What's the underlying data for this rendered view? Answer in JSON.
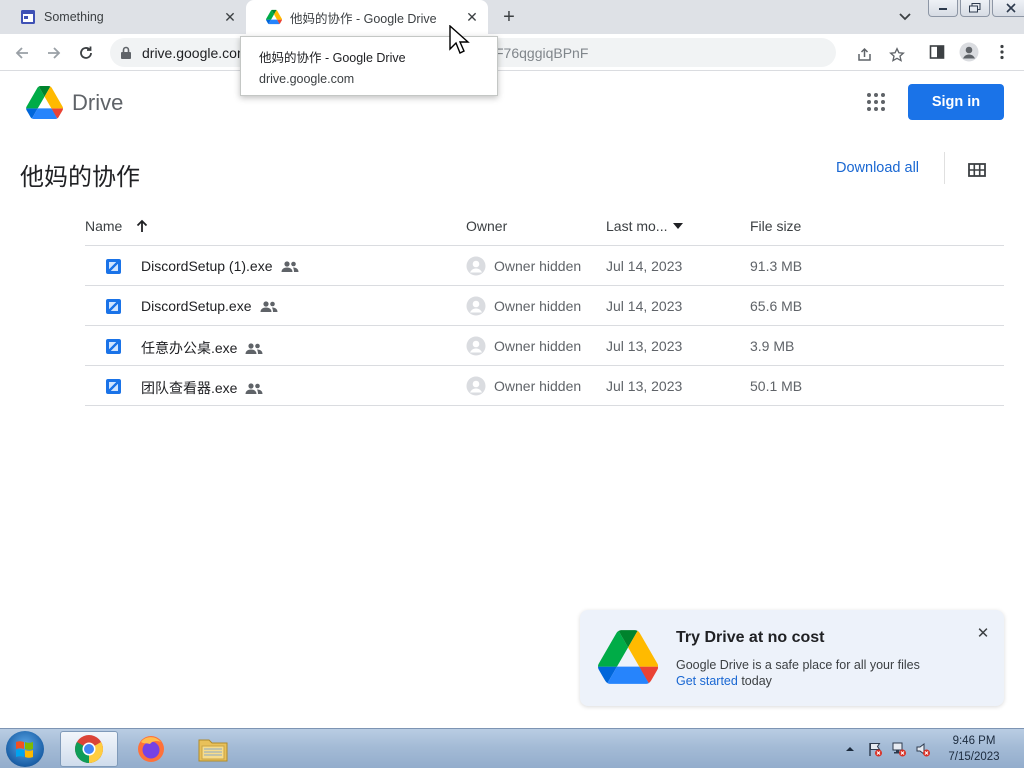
{
  "browser": {
    "tabs": [
      {
        "title": "Something",
        "active": false
      },
      {
        "title": "他妈的协作 - Google Drive",
        "active": true
      }
    ],
    "address": {
      "host": "drive.google.com",
      "path_tail": "F76qggiqBPnF"
    },
    "tooltip": {
      "title": "他妈的协作 - Google Drive",
      "url": "drive.google.com"
    }
  },
  "drive": {
    "brand": "Drive",
    "sign_in_label": "Sign in",
    "folder_title": "他妈的协作",
    "download_all_label": "Download all",
    "columns": {
      "name": "Name",
      "owner": "Owner",
      "modified": "Last mo...",
      "size": "File size"
    },
    "files": [
      {
        "name": "DiscordSetup (1).exe",
        "owner": "Owner hidden",
        "modified": "Jul 14, 2023",
        "size": "91.3 MB"
      },
      {
        "name": "DiscordSetup.exe",
        "owner": "Owner hidden",
        "modified": "Jul 14, 2023",
        "size": "65.6 MB"
      },
      {
        "name": "任意办公桌.exe",
        "owner": "Owner hidden",
        "modified": "Jul 13, 2023",
        "size": "3.9 MB"
      },
      {
        "name": "团队查看器.exe",
        "owner": "Owner hidden",
        "modified": "Jul 13, 2023",
        "size": "50.1 MB"
      }
    ],
    "promo": {
      "title": "Try Drive at no cost",
      "line1": "Google Drive is a safe place for all your files",
      "link": "Get started",
      "line2_rest": " today"
    }
  },
  "taskbar": {
    "time": "9:46 PM",
    "date": "7/15/2023"
  },
  "colors": {
    "accent": "#1a73e8",
    "link": "#1967d2",
    "tabstrip": "#dee1e6",
    "promo_bg": "#edf2fa"
  }
}
